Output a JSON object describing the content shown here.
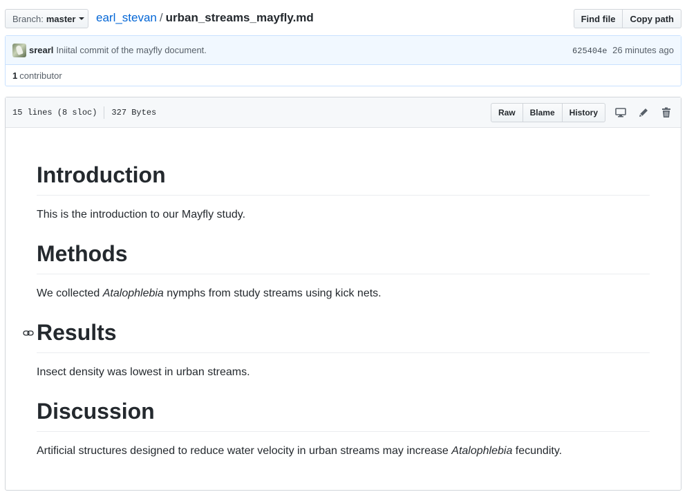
{
  "topbar": {
    "branch_label": "Branch:",
    "branch_name": "master",
    "owner": "earl_stevan",
    "separator": "/",
    "filename": "urban_streams_mayfly.md",
    "find_file": "Find file",
    "copy_path": "Copy path"
  },
  "commit": {
    "author": "srearl",
    "message": "Iniital commit of the mayfly document.",
    "sha": "625404e",
    "time": "26 minutes ago"
  },
  "contributors": {
    "count": "1",
    "label": "contributor"
  },
  "file": {
    "lines": "15 lines (8 sloc)",
    "size": "327 Bytes",
    "raw": "Raw",
    "blame": "Blame",
    "history": "History"
  },
  "icons": [
    "desktop-icon",
    "pencil-icon",
    "trash-icon",
    "link-icon"
  ],
  "content": {
    "h1": "Introduction",
    "p1": "This is the introduction to our Mayfly study.",
    "h2": "Methods",
    "p2_pre": "We collected ",
    "p2_em": "Atalophlebia",
    "p2_post": " nymphs from study streams using kick nets.",
    "h3": "Results",
    "p3": "Insect density was lowest in urban streams.",
    "h4": "Discussion",
    "p4_pre": "Artificial structures designed to reduce water velocity in urban streams may increase ",
    "p4_em": "Atalophlebia",
    "p4_post": " fecundity."
  }
}
